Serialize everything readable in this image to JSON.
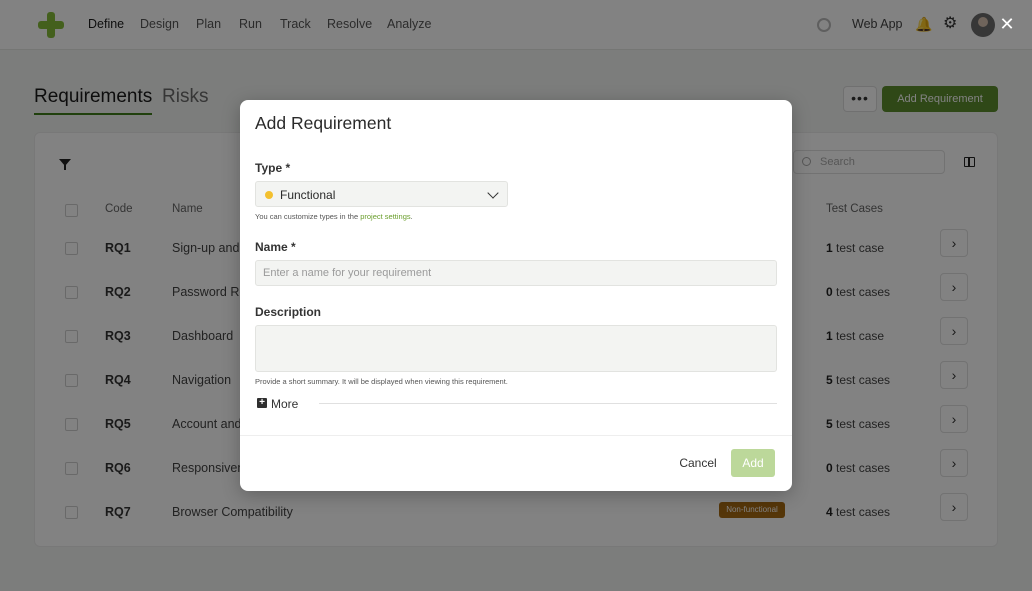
{
  "topnav": {
    "items": [
      "Define",
      "Design",
      "Plan",
      "Run",
      "Track",
      "Resolve",
      "Analyze"
    ],
    "active": "Define",
    "app_name": "Web App"
  },
  "page": {
    "tabs": [
      "Requirements",
      "Risks"
    ],
    "active_tab": "Requirements",
    "more_label": "•••",
    "add_button": "Add Requirement",
    "search_placeholder": "Search"
  },
  "table": {
    "headers": {
      "code": "Code",
      "name": "Name",
      "test_cases": "Test Cases"
    },
    "rows": [
      {
        "code": "RQ1",
        "name": "Sign-up and L",
        "tc_count": "1",
        "tc_unit": "test case"
      },
      {
        "code": "RQ2",
        "name": "Password Rec",
        "tc_count": "0",
        "tc_unit": "test cases"
      },
      {
        "code": "RQ3",
        "name": "Dashboard",
        "tc_count": "1",
        "tc_unit": "test case"
      },
      {
        "code": "RQ4",
        "name": "Navigation",
        "tc_count": "5",
        "tc_unit": "test cases"
      },
      {
        "code": "RQ5",
        "name": "Account and F",
        "tc_count": "5",
        "tc_unit": "test cases"
      },
      {
        "code": "RQ6",
        "name": "Responsivene",
        "tc_count": "0",
        "tc_unit": "test cases"
      },
      {
        "code": "RQ7",
        "name": "Browser Compatibility",
        "tc_count": "4",
        "tc_unit": "test cases",
        "badge": "Non-functional"
      }
    ]
  },
  "modal": {
    "title": "Add Requirement",
    "type_label": "Type *",
    "type_value": "Functional",
    "type_color": "#f3c02f",
    "type_hint_prefix": "You can customize types in the ",
    "type_hint_link": "project settings",
    "type_hint_suffix": ".",
    "name_label": "Name *",
    "name_placeholder": "Enter a name for your requirement",
    "description_label": "Description",
    "description_hint": "Provide a short summary. It will be displayed when viewing this requirement.",
    "more_label": "More",
    "cancel_label": "Cancel",
    "add_label": "Add"
  },
  "colors": {
    "brand": "#86bd3a",
    "primary_button": "#5c8d2e",
    "disabled_add": "#bcd89a",
    "link": "#6a9e2c"
  }
}
